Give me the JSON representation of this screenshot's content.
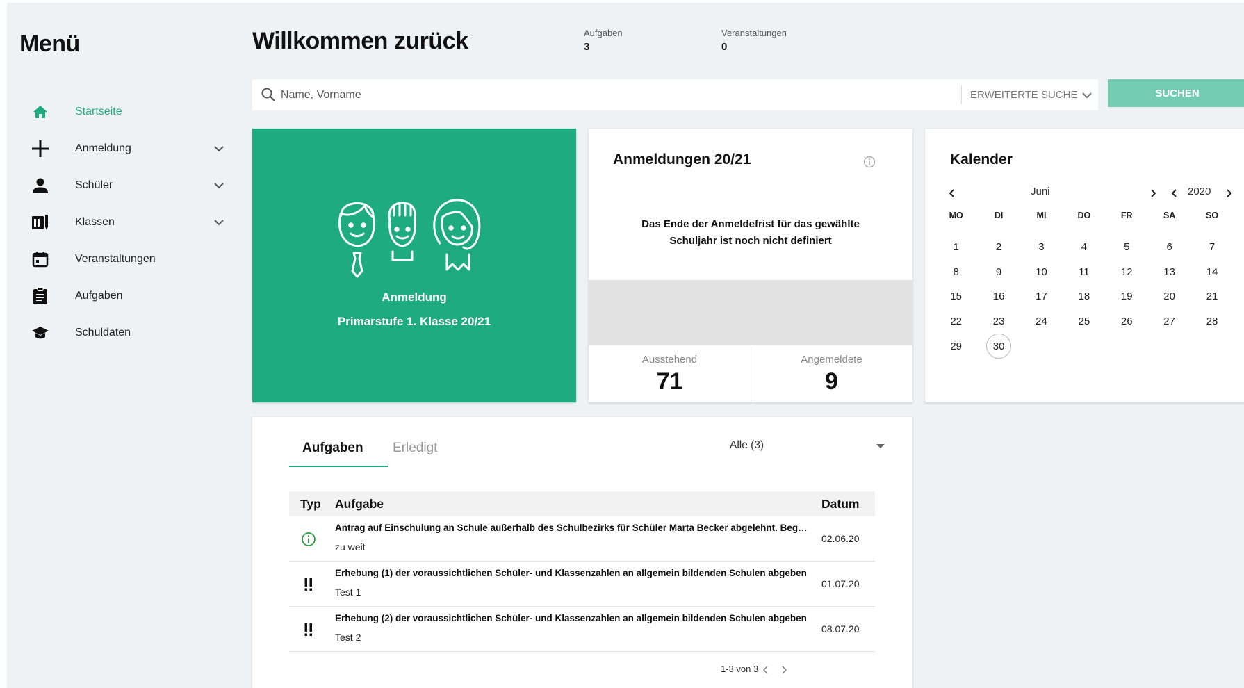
{
  "sidebar": {
    "title": "Menü",
    "items": [
      {
        "label": "Startseite",
        "icon": "home-icon",
        "active": true,
        "expandable": false
      },
      {
        "label": "Anmeldung",
        "icon": "plus-icon",
        "active": false,
        "expandable": true
      },
      {
        "label": "Schüler",
        "icon": "person-icon",
        "active": false,
        "expandable": true
      },
      {
        "label": "Klassen",
        "icon": "book-icon",
        "active": false,
        "expandable": true
      },
      {
        "label": "Veranstaltungen",
        "icon": "calendar-icon",
        "active": false,
        "expandable": false
      },
      {
        "label": "Aufgaben",
        "icon": "clipboard-icon",
        "active": false,
        "expandable": false
      },
      {
        "label": "Schuldaten",
        "icon": "graduation-cap-icon",
        "active": false,
        "expandable": false
      }
    ]
  },
  "header": {
    "title": "Willkommen zurück",
    "stats": [
      {
        "label": "Aufgaben",
        "value": "3"
      },
      {
        "label": "Veranstaltungen",
        "value": "0"
      }
    ]
  },
  "search": {
    "placeholder": "Name, Vorname",
    "value": "",
    "advanced_label": "ERWEITERTE SUCHE",
    "button_label": "SUCHEN"
  },
  "registration_tile": {
    "line1": "Anmeldung",
    "line2": "Primarstufe 1. Klasse 20/21"
  },
  "registrations_card": {
    "title": "Anmeldungen 20/21",
    "message": "Das Ende der Anmeldefrist für das gewählte Schuljahr ist noch nicht definiert",
    "pending_label": "Ausstehend",
    "pending_value": "71",
    "registered_label": "Angemeldete",
    "registered_value": "9"
  },
  "calendar": {
    "title": "Kalender",
    "month": "Juni",
    "year": "2020",
    "weekdays": [
      "MO",
      "DI",
      "MI",
      "DO",
      "FR",
      "SA",
      "SO"
    ],
    "weeks": [
      [
        "1",
        "2",
        "3",
        "4",
        "5",
        "6",
        "7"
      ],
      [
        "8",
        "9",
        "10",
        "11",
        "12",
        "13",
        "14"
      ],
      [
        "15",
        "16",
        "17",
        "18",
        "19",
        "20",
        "21"
      ],
      [
        "22",
        "23",
        "24",
        "25",
        "26",
        "27",
        "28"
      ],
      [
        "29",
        "30",
        "",
        "",
        "",
        "",
        ""
      ]
    ],
    "today": "30"
  },
  "tasks": {
    "tabs": [
      "Aufgaben",
      "Erledigt"
    ],
    "active_tab": 0,
    "filter_value": "Alle (3)",
    "columns": {
      "type": "Typ",
      "task": "Aufgabe",
      "date": "Datum"
    },
    "rows": [
      {
        "type": "info",
        "title": "Antrag auf Einschulung an Schule außerhalb des Schulbezirks für Schüler Marta Becker abgelehnt. Begründung",
        "subtitle": "zu weit",
        "date": "02.06.20"
      },
      {
        "type": "urgent",
        "title": "Erhebung (1) der voraussichtlichen Schüler- und Klassenzahlen an allgemein bildenden Schulen abgeben",
        "subtitle": "Test 1",
        "date": "01.07.20"
      },
      {
        "type": "urgent",
        "title": "Erhebung (2) der voraussichtlichen Schüler- und Klassenzahlen an allgemein bildenden Schulen abgeben",
        "subtitle": "Test 2",
        "date": "08.07.20"
      }
    ],
    "pagination": "1-3 von 3"
  },
  "colors": {
    "accent": "#1eac7f",
    "accent_light": "#74ccb0",
    "background": "#eff2f4"
  }
}
